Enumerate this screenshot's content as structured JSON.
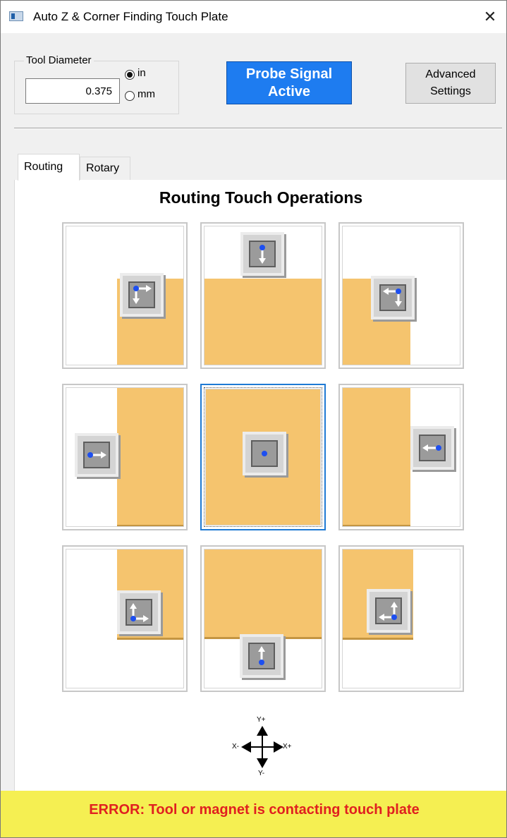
{
  "window": {
    "title": "Auto Z & Corner Finding Touch Plate",
    "close_glyph": "✕"
  },
  "tool_diameter": {
    "label": "Tool Diameter",
    "value": "0.375",
    "units": [
      {
        "label": "in",
        "selected": true
      },
      {
        "label": "mm",
        "selected": false
      }
    ]
  },
  "probe_signal": {
    "line1": "Probe Signal",
    "line2": "Active",
    "color": "#1e7cf0"
  },
  "advanced_settings": {
    "line1": "Advanced",
    "line2": "Settings"
  },
  "tabs": [
    {
      "label": "Routing",
      "active": true
    },
    {
      "label": "Rotary",
      "active": false
    }
  ],
  "panel": {
    "title": "Routing Touch Operations",
    "selected_operation": "center",
    "operations": [
      {
        "id": "top-left",
        "arrow-icons": [
          "right-arrow-icon",
          "down-arrow-icon"
        ]
      },
      {
        "id": "top",
        "arrow-icons": [
          "down-arrow-icon"
        ]
      },
      {
        "id": "top-right",
        "arrow-icons": [
          "left-arrow-icon",
          "down-arrow-icon"
        ]
      },
      {
        "id": "left",
        "arrow-icons": [
          "right-arrow-icon"
        ]
      },
      {
        "id": "center",
        "arrow-icons": []
      },
      {
        "id": "right",
        "arrow-icons": [
          "left-arrow-icon"
        ]
      },
      {
        "id": "bottom-left",
        "arrow-icons": [
          "right-arrow-icon",
          "up-arrow-icon"
        ]
      },
      {
        "id": "bottom",
        "arrow-icons": [
          "up-arrow-icon"
        ]
      },
      {
        "id": "bottom-right",
        "arrow-icons": [
          "left-arrow-icon",
          "up-arrow-icon"
        ]
      }
    ],
    "colors": {
      "material": "#f5c46e",
      "probe_dot": "#1d4ff0"
    }
  },
  "axes": {
    "y_plus": "Y+",
    "y_minus": "Y-",
    "x_minus": "X-",
    "x_plus": "X+"
  },
  "status": {
    "message": "ERROR: Tool or magnet is contacting touch plate",
    "text_color": "#e02020",
    "bar_color": "#f5ef52"
  }
}
